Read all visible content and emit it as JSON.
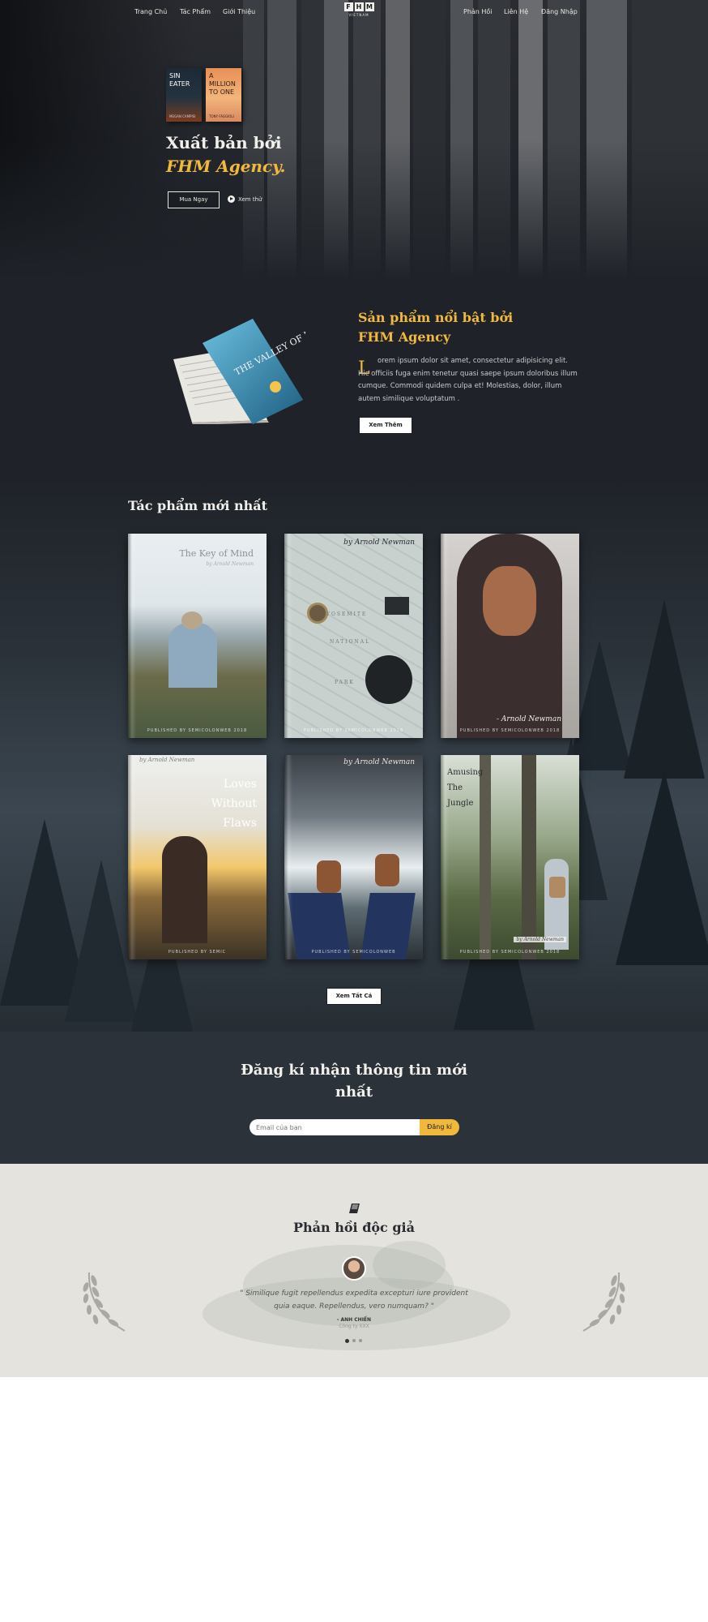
{
  "nav": {
    "left": [
      "Trang Chủ",
      "Tác Phẩm",
      "Giới Thiệu"
    ],
    "right": [
      "Phản Hồi",
      "Liên Hệ",
      "Đăng Nhập"
    ],
    "logo_letters": [
      "F",
      "H",
      "M"
    ],
    "logo_sub": "VIETNAM"
  },
  "hero": {
    "covers": [
      {
        "title": "SIN EATER",
        "author": "MEGAN CAMPISI"
      },
      {
        "title": "A MILLION TO ONE",
        "author": "TONY FAGGIOLI"
      }
    ],
    "title_line1": "Xuất bản bởi",
    "title_line2": "FHM Agency.",
    "buy_label": "Mua Ngay",
    "watch_label": "Xem thử"
  },
  "featured": {
    "title_line1": "Sản phẩm nổi bật bởi",
    "title_line2": "FHM Agency",
    "drop_cap": "L",
    "text": "orem ipsum dolor sit amet, consectetur adipisicing elit. Hic officiis fuga enim tenetur quasi saepe ipsum doloribus illum cumque. Commodi quidem culpa et! Molestias, dolor, illum autem similique voluptatum .",
    "more_label": "Xem Thêm",
    "book_title": "THE VALLEY OF DEAD BIRDS"
  },
  "works": {
    "title": "Tác phẩm mới nhất",
    "books": [
      {
        "title": "The Key of Mind",
        "author": "by Arnold Newman",
        "publisher": "PUBLISHED BY SEMICOLONWEB 2018"
      },
      {
        "title": "",
        "author": "by Arnold Newman",
        "publisher": "PUBLISHED BY SEMICOLONWEB 2018"
      },
      {
        "title": "",
        "author": "- Arnold Newman",
        "publisher": "PUBLISHED BY SEMICOLONWEB 2018"
      },
      {
        "title": "Loves Without Flaws",
        "author": "by Arnold Newman",
        "publisher": "PUBLISHED BY SEMIC"
      },
      {
        "title": "",
        "author": "by Arnold Newman",
        "publisher": "PUBLISHED BY SEMICOLONWEB"
      },
      {
        "title": "Amusing The Jungle",
        "author": "by Arnold Newman",
        "publisher": "PUBLISHED BY SEMICOLONWEB 2018"
      }
    ],
    "map_words": [
      "YOSEMITE",
      "NATIONAL",
      "PARK"
    ],
    "all_label": "Xem Tất Cả"
  },
  "newsletter": {
    "title": "Đăng kí nhận thông tin mới nhất",
    "placeholder": "Email của bạn",
    "submit_label": "Đăng kí"
  },
  "reviews": {
    "title": "Phản hồi độc giả",
    "quote": "\" Similique fugit repellendus expedita excepturi iure provident quia eaque. Repellendus, vero numquam? \"",
    "author": "- ANH CHIẾN",
    "company": "Công ty XXX"
  },
  "colors": {
    "accent": "#f1b93c",
    "dark": "#1f2329",
    "light": "#e5e3de"
  }
}
